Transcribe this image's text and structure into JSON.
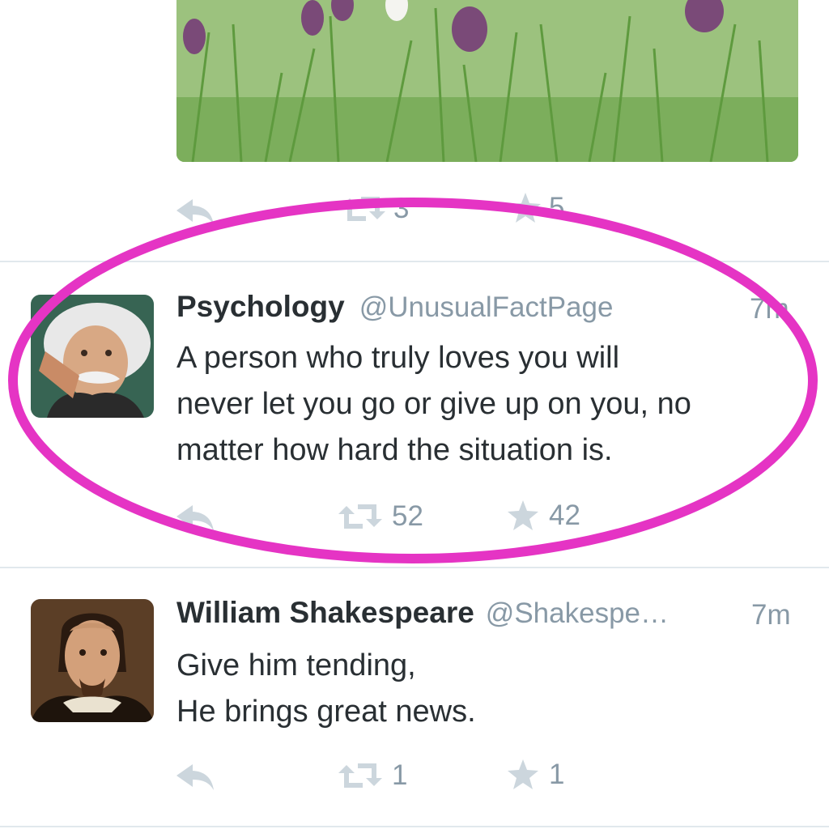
{
  "top_tweet": {
    "retweet_count": "3",
    "favorite_count": "5"
  },
  "tweets": [
    {
      "display_name": "Psychology",
      "handle": "@UnusualFactPage",
      "time": "7m",
      "text_lines": [
        "A person who truly loves you will",
        "never let you go or give up on you, no",
        "matter how hard the situation is."
      ],
      "retweet_count": "52",
      "favorite_count": "42"
    },
    {
      "display_name": "William Shakespeare",
      "handle": "@Shakespe…",
      "time": "7m",
      "text_lines": [
        "Give him tending,",
        "He brings great news."
      ],
      "retweet_count": "1",
      "favorite_count": "1"
    }
  ],
  "icons": {
    "reply": "reply-icon",
    "retweet": "retweet-icon",
    "favorite": "star-icon"
  },
  "colors": {
    "highlight": "#e534c4",
    "icon_gray": "#ccd6dd",
    "text": "#292f33",
    "muted": "#8899a6"
  }
}
